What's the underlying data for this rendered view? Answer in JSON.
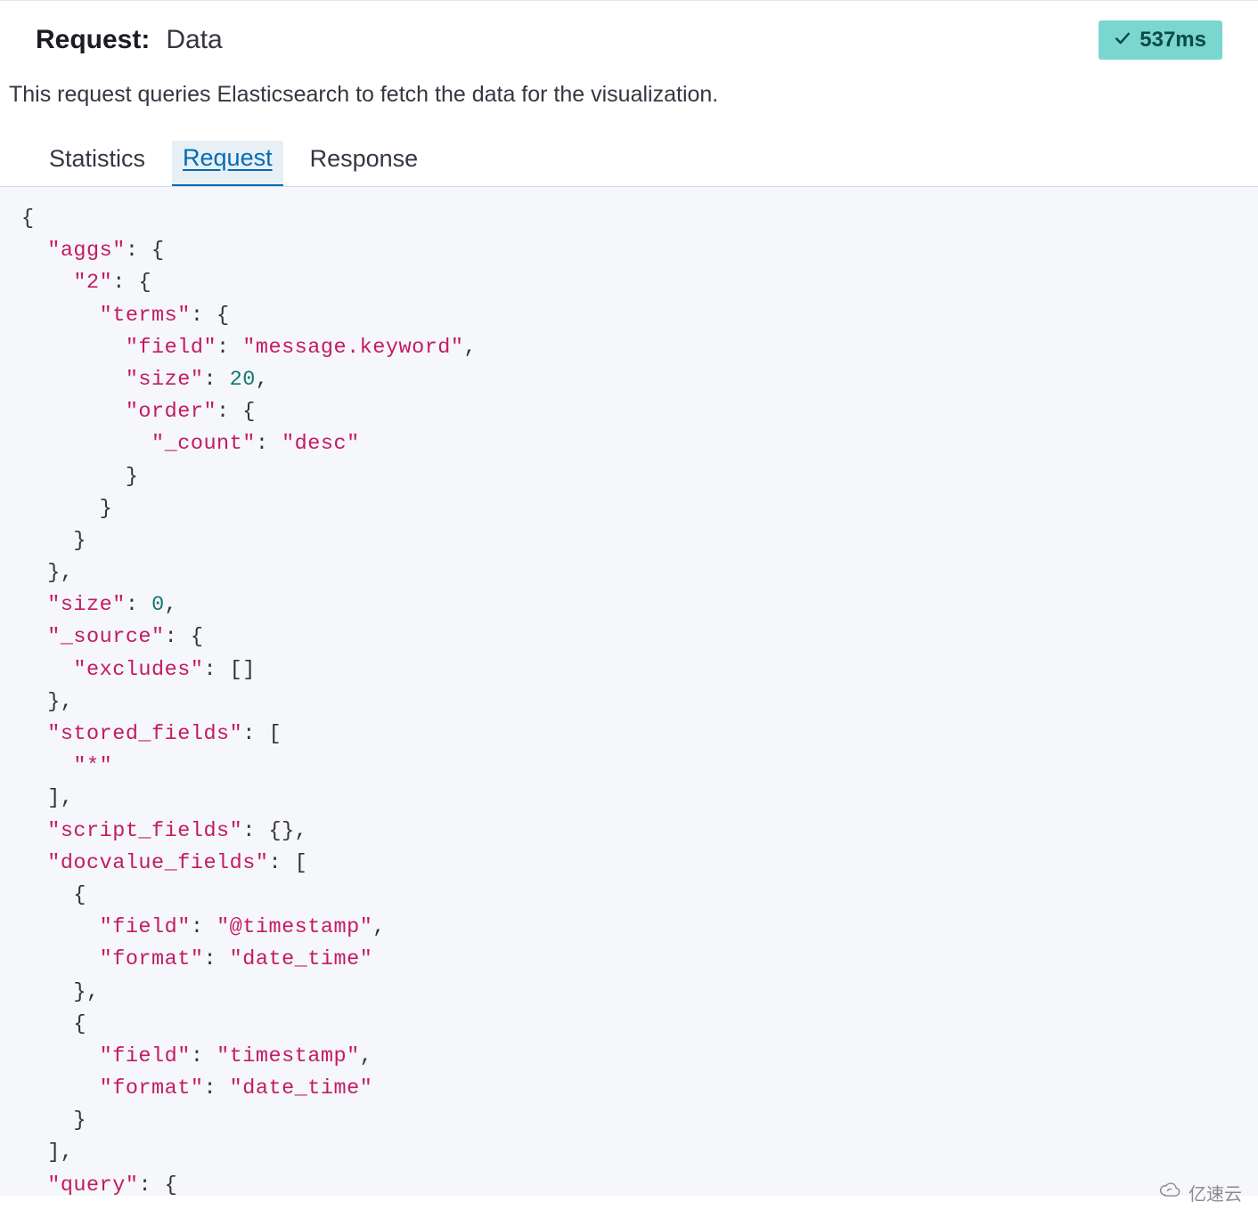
{
  "header": {
    "title_label": "Request:",
    "title_value": "Data",
    "timing": "537ms"
  },
  "description": "This request queries Elasticsearch to fetch the data for the visualization.",
  "tabs": {
    "statistics": "Statistics",
    "request": "Request",
    "response": "Response",
    "selected": "request"
  },
  "code": {
    "tokens": [
      {
        "t": "{",
        "c": "p"
      },
      {
        "t": "\n  ",
        "c": "p"
      },
      {
        "t": "\"aggs\"",
        "c": "s"
      },
      {
        "t": ": {",
        "c": "p"
      },
      {
        "t": "\n    ",
        "c": "p"
      },
      {
        "t": "\"2\"",
        "c": "s"
      },
      {
        "t": ": {",
        "c": "p"
      },
      {
        "t": "\n      ",
        "c": "p"
      },
      {
        "t": "\"terms\"",
        "c": "s"
      },
      {
        "t": ": {",
        "c": "p"
      },
      {
        "t": "\n        ",
        "c": "p"
      },
      {
        "t": "\"field\"",
        "c": "s"
      },
      {
        "t": ": ",
        "c": "p"
      },
      {
        "t": "\"message.keyword\"",
        "c": "s"
      },
      {
        "t": ",",
        "c": "p"
      },
      {
        "t": "\n        ",
        "c": "p"
      },
      {
        "t": "\"size\"",
        "c": "s"
      },
      {
        "t": ": ",
        "c": "p"
      },
      {
        "t": "20",
        "c": "n"
      },
      {
        "t": ",",
        "c": "p"
      },
      {
        "t": "\n        ",
        "c": "p"
      },
      {
        "t": "\"order\"",
        "c": "s"
      },
      {
        "t": ": {",
        "c": "p"
      },
      {
        "t": "\n          ",
        "c": "p"
      },
      {
        "t": "\"_count\"",
        "c": "s"
      },
      {
        "t": ": ",
        "c": "p"
      },
      {
        "t": "\"desc\"",
        "c": "s"
      },
      {
        "t": "\n        }",
        "c": "p"
      },
      {
        "t": "\n      }",
        "c": "p"
      },
      {
        "t": "\n    }",
        "c": "p"
      },
      {
        "t": "\n  },",
        "c": "p"
      },
      {
        "t": "\n  ",
        "c": "p"
      },
      {
        "t": "\"size\"",
        "c": "s"
      },
      {
        "t": ": ",
        "c": "p"
      },
      {
        "t": "0",
        "c": "n"
      },
      {
        "t": ",",
        "c": "p"
      },
      {
        "t": "\n  ",
        "c": "p"
      },
      {
        "t": "\"_source\"",
        "c": "s"
      },
      {
        "t": ": {",
        "c": "p"
      },
      {
        "t": "\n    ",
        "c": "p"
      },
      {
        "t": "\"excludes\"",
        "c": "s"
      },
      {
        "t": ": []",
        "c": "p"
      },
      {
        "t": "\n  },",
        "c": "p"
      },
      {
        "t": "\n  ",
        "c": "p"
      },
      {
        "t": "\"stored_fields\"",
        "c": "s"
      },
      {
        "t": ": [",
        "c": "p"
      },
      {
        "t": "\n    ",
        "c": "p"
      },
      {
        "t": "\"*\"",
        "c": "s"
      },
      {
        "t": "\n  ],",
        "c": "p"
      },
      {
        "t": "\n  ",
        "c": "p"
      },
      {
        "t": "\"script_fields\"",
        "c": "s"
      },
      {
        "t": ": {},",
        "c": "p"
      },
      {
        "t": "\n  ",
        "c": "p"
      },
      {
        "t": "\"docvalue_fields\"",
        "c": "s"
      },
      {
        "t": ": [",
        "c": "p"
      },
      {
        "t": "\n    {",
        "c": "p"
      },
      {
        "t": "\n      ",
        "c": "p"
      },
      {
        "t": "\"field\"",
        "c": "s"
      },
      {
        "t": ": ",
        "c": "p"
      },
      {
        "t": "\"@timestamp\"",
        "c": "s"
      },
      {
        "t": ",",
        "c": "p"
      },
      {
        "t": "\n      ",
        "c": "p"
      },
      {
        "t": "\"format\"",
        "c": "s"
      },
      {
        "t": ": ",
        "c": "p"
      },
      {
        "t": "\"date_time\"",
        "c": "s"
      },
      {
        "t": "\n    },",
        "c": "p"
      },
      {
        "t": "\n    {",
        "c": "p"
      },
      {
        "t": "\n      ",
        "c": "p"
      },
      {
        "t": "\"field\"",
        "c": "s"
      },
      {
        "t": ": ",
        "c": "p"
      },
      {
        "t": "\"timestamp\"",
        "c": "s"
      },
      {
        "t": ",",
        "c": "p"
      },
      {
        "t": "\n      ",
        "c": "p"
      },
      {
        "t": "\"format\"",
        "c": "s"
      },
      {
        "t": ": ",
        "c": "p"
      },
      {
        "t": "\"date_time\"",
        "c": "s"
      },
      {
        "t": "\n    }",
        "c": "p"
      },
      {
        "t": "\n  ],",
        "c": "p"
      },
      {
        "t": "\n  ",
        "c": "p"
      },
      {
        "t": "\"query\"",
        "c": "s"
      },
      {
        "t": ": {",
        "c": "p"
      }
    ]
  },
  "watermark": "亿速云"
}
